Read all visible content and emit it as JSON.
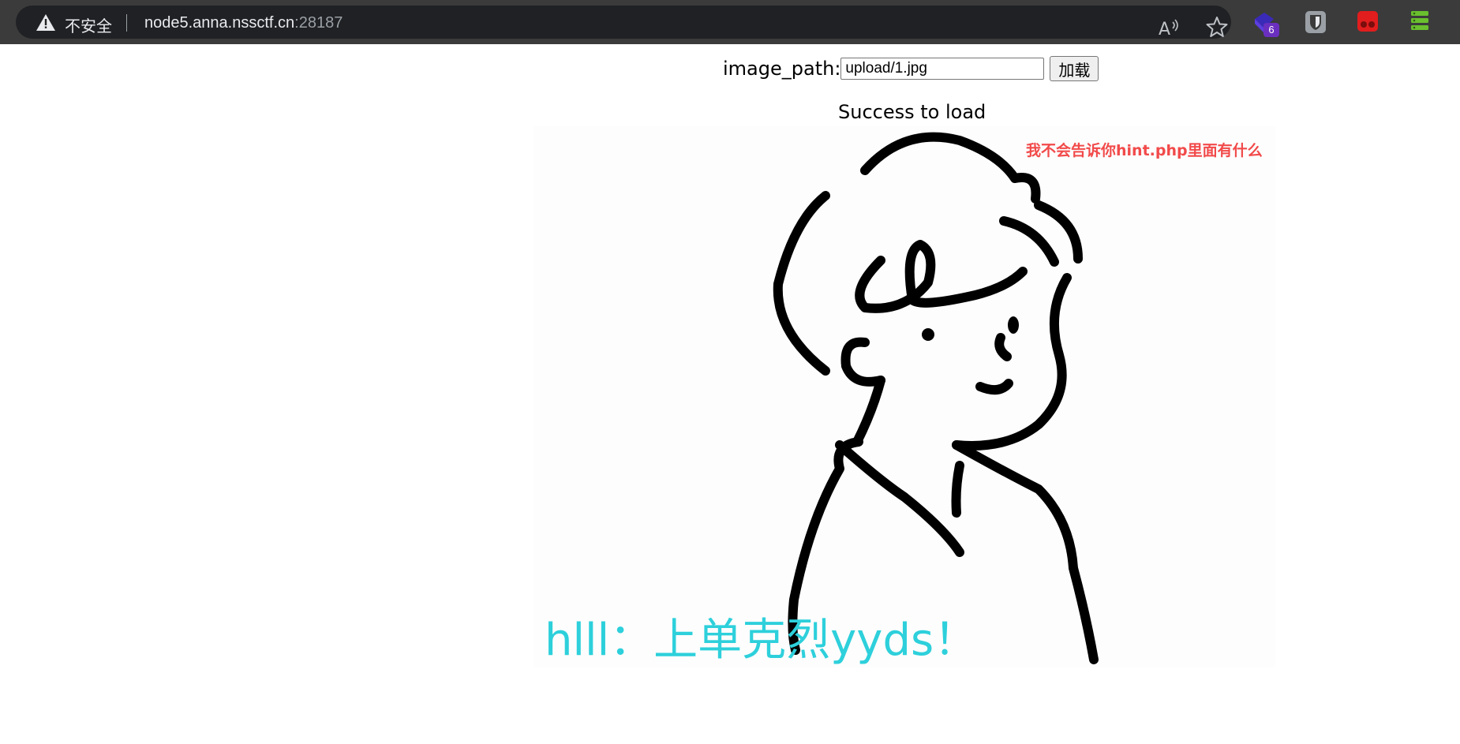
{
  "browser": {
    "security_label": "不安全",
    "url_host": "node5.anna.nssctf.cn",
    "url_port": ":28187",
    "extension_badge": "6",
    "icons": [
      "warning-icon",
      "read-aloud-icon",
      "star-icon",
      "gem-extension-icon",
      "shield-extension-icon",
      "red-extension-icon",
      "green-extension-icon"
    ]
  },
  "form": {
    "label": "image_path:",
    "input_value": "upload/1.jpg",
    "button_label": "加载"
  },
  "status_text": "Success to load",
  "image": {
    "hint_text": "我不会告诉你hint.php里面有什么",
    "caption_text": "hlll：上单克烈yyds！"
  }
}
